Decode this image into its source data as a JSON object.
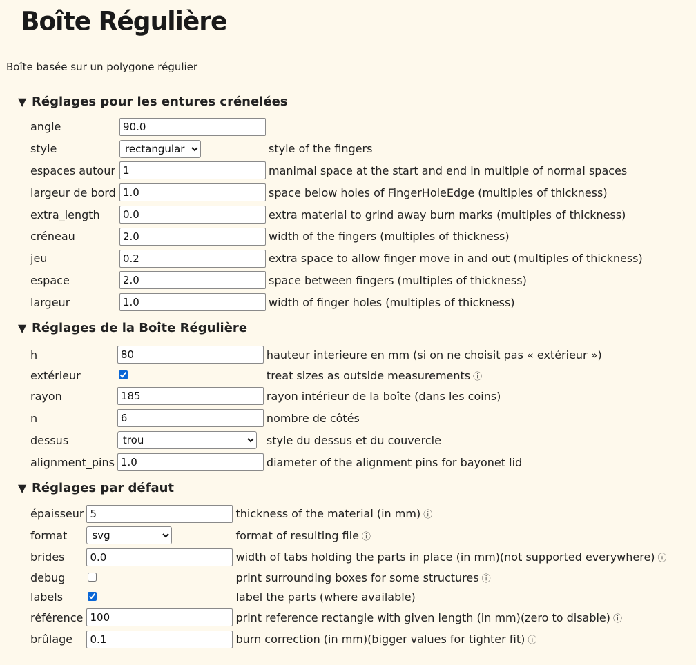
{
  "page": {
    "title": "Boîte Régulière",
    "subtitle": "Boîte basée sur un polygone régulier"
  },
  "sections": [
    {
      "heading": "Réglages pour les entures crénelées",
      "rows": [
        {
          "label": "angle",
          "value": "90.0",
          "desc": ""
        },
        {
          "label": "style",
          "value": "rectangular",
          "desc": "style of the fingers"
        },
        {
          "label": "espaces autour",
          "value": "1",
          "desc": "manimal space at the start and end in multiple of normal spaces"
        },
        {
          "label": "largeur de bord",
          "value": "1.0",
          "desc": "space below holes of FingerHoleEdge (multiples of thickness)"
        },
        {
          "label": "extra_length",
          "value": "0.0",
          "desc": "extra material to grind away burn marks (multiples of thickness)"
        },
        {
          "label": "créneau",
          "value": "2.0",
          "desc": "width of the fingers (multiples of thickness)"
        },
        {
          "label": "jeu",
          "value": "0.2",
          "desc": "extra space to allow finger move in and out (multiples of thickness)"
        },
        {
          "label": "espace",
          "value": "2.0",
          "desc": "space between fingers (multiples of thickness)"
        },
        {
          "label": "largeur",
          "value": "1.0",
          "desc": "width of finger holes (multiples of thickness)"
        }
      ]
    },
    {
      "heading": "Réglages de la Boîte Régulière",
      "rows": [
        {
          "label": "h",
          "value": "80",
          "desc": "hauteur interieure en mm (si on ne choisit pas « extérieur »)"
        },
        {
          "label": "extérieur",
          "checked": true,
          "desc": "treat sizes as outside measurements",
          "info": "ⓘ"
        },
        {
          "label": "rayon",
          "value": "185",
          "desc": "rayon intérieur de la boîte (dans les coins)"
        },
        {
          "label": "n",
          "value": "6",
          "desc": "nombre de côtés"
        },
        {
          "label": "dessus",
          "value": "trou",
          "desc": "style du dessus et du couvercle"
        },
        {
          "label": "alignment_pins",
          "value": "1.0",
          "desc": "diameter of the alignment pins for bayonet lid"
        }
      ]
    },
    {
      "heading": "Réglages par défaut",
      "rows": [
        {
          "label": "épaisseur",
          "value": "5",
          "desc": "thickness of the material (in mm)",
          "info": "ⓘ"
        },
        {
          "label": "format",
          "value": "svg",
          "desc": "format of resulting file",
          "info": "ⓘ"
        },
        {
          "label": "brides",
          "value": "0.0",
          "desc": "width of tabs holding the parts in place (in mm)(not supported everywhere)",
          "info": "ⓘ"
        },
        {
          "label": "debug",
          "checked": false,
          "desc": "print surrounding boxes for some structures",
          "info": "ⓘ"
        },
        {
          "label": "labels",
          "checked": true,
          "desc": "label the parts (where available)"
        },
        {
          "label": "référence",
          "value": "100",
          "desc": "print reference rectangle with given length (in mm)(zero to disable)",
          "info": "ⓘ"
        },
        {
          "label": "brûlage",
          "value": "0.1",
          "desc": "burn correction (in mm)(bigger values for tighter fit)",
          "info": "ⓘ"
        }
      ]
    }
  ],
  "icons": {
    "section_toggle": "triangle-down-icon",
    "info": "info-icon"
  },
  "colors": {
    "background": "#fef9ec",
    "checkbox_accent": "#0a66d6"
  }
}
